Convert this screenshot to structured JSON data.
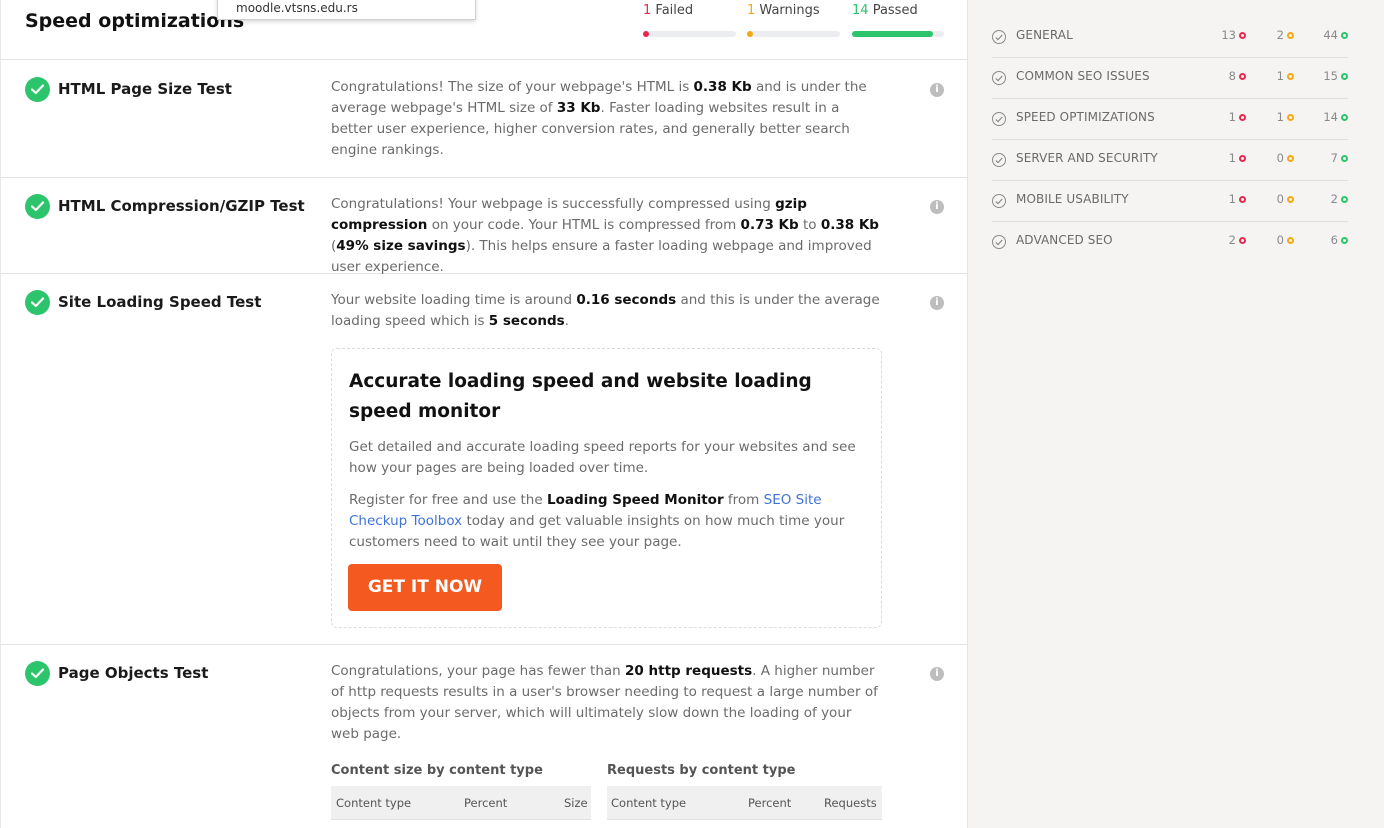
{
  "header": {
    "title": "Speed optimizations",
    "url_tooltip": "moodle.vtsns.edu.rs",
    "stats": {
      "failed_count": "1",
      "failed_label": "Failed",
      "warnings_count": "1",
      "warnings_label": "Warnings",
      "passed_count": "14",
      "passed_label": "Passed",
      "passed_fraction": 0.88
    }
  },
  "tests": [
    {
      "title": "HTML Page Size Test",
      "desc": [
        "Congratulations! The size of your webpage's HTML is ",
        "0.38 Kb",
        " and is under the average webpage's HTML size of ",
        "33 Kb",
        ". Faster loading websites result in a better user experience, higher conversion rates, and generally better search engine rankings."
      ]
    },
    {
      "title": "HTML Compression/GZIP Test",
      "desc": [
        "Congratulations! Your webpage is successfully compressed using ",
        "gzip compression",
        " on your code. Your HTML is compressed from ",
        "0.73 Kb",
        " to ",
        "0.38 Kb",
        " (",
        "49% size savings",
        "). This helps ensure a faster loading webpage and improved user experience."
      ]
    },
    {
      "title": "Site Loading Speed Test",
      "desc": [
        "Your website loading time is around ",
        "0.16 seconds",
        " and this is under the average loading speed which is ",
        "5 seconds",
        "."
      ]
    },
    {
      "title": "Page Objects Test",
      "desc": [
        "Congratulations, your page has fewer than ",
        "20 http requests",
        ". A higher number of http requests results in a user's browser needing to request a large number of objects from your server, which will ultimately slow down the loading of your web page."
      ]
    }
  ],
  "promo": {
    "title": "Accurate loading speed and website loading speed monitor",
    "p1": "Get detailed and accurate loading speed reports for your websites and see how your pages are being loaded over time.",
    "p2_a": "Register for free and use the ",
    "p2_b": "Loading Speed Monitor",
    "p2_c": " from ",
    "p2_link": "SEO Site Checkup Toolbox",
    "p2_d": " today and get valuable insights on how much time your customers need to wait until they see your page.",
    "button": "GET IT NOW"
  },
  "tables": {
    "size": {
      "caption": "Content size by content type",
      "cols": [
        "Content type",
        "Percent",
        "Size"
      ]
    },
    "requests": {
      "caption": "Requests by content type",
      "cols": [
        "Content type",
        "Percent",
        "Requests"
      ]
    }
  },
  "sidebar": [
    {
      "label": "GENERAL",
      "failed": "13",
      "warnings": "2",
      "passed": "44"
    },
    {
      "label": "COMMON SEO ISSUES",
      "failed": "8",
      "warnings": "1",
      "passed": "15"
    },
    {
      "label": "SPEED OPTIMIZATIONS",
      "failed": "1",
      "warnings": "1",
      "passed": "14"
    },
    {
      "label": "SERVER AND SECURITY",
      "failed": "1",
      "warnings": "0",
      "passed": "7"
    },
    {
      "label": "MOBILE USABILITY",
      "failed": "1",
      "warnings": "0",
      "passed": "2"
    },
    {
      "label": "ADVANCED SEO",
      "failed": "2",
      "warnings": "0",
      "passed": "6"
    }
  ],
  "colors": {
    "failed": "#e8284f",
    "warning": "#f4a816",
    "passed": "#2dc56b",
    "button": "#f4591f",
    "link": "#3f73d6"
  }
}
